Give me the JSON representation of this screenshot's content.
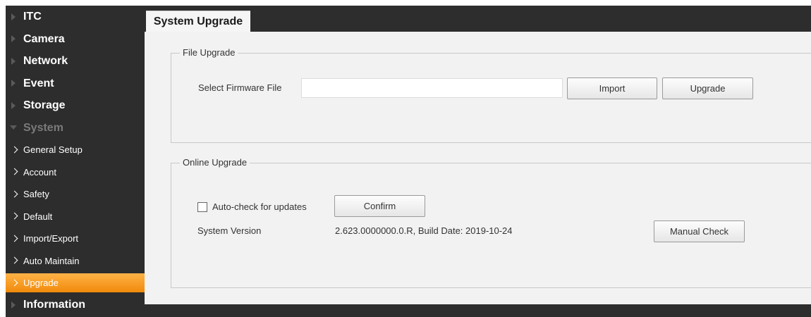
{
  "sidebar": {
    "sections_top": [
      {
        "label": "ITC"
      },
      {
        "label": "Camera"
      },
      {
        "label": "Network"
      },
      {
        "label": "Event"
      },
      {
        "label": "Storage"
      }
    ],
    "system": {
      "label": "System"
    },
    "system_items": [
      {
        "label": "General Setup"
      },
      {
        "label": "Account"
      },
      {
        "label": "Safety"
      },
      {
        "label": "Default"
      },
      {
        "label": "Import/Export"
      },
      {
        "label": "Auto Maintain"
      },
      {
        "label": "Upgrade"
      }
    ],
    "information": {
      "label": "Information"
    }
  },
  "tab": {
    "label": "System Upgrade"
  },
  "file_upgrade": {
    "legend": "File Upgrade",
    "select_label": "Select Firmware File",
    "file_value": "",
    "import_label": "Import",
    "upgrade_label": "Upgrade"
  },
  "online_upgrade": {
    "legend": "Online Upgrade",
    "autocheck_label": "Auto-check for updates",
    "autocheck_checked": false,
    "confirm_label": "Confirm",
    "version_label": "System Version",
    "version_value": "2.623.0000000.0.R, Build Date: 2019-10-24",
    "manual_check_label": "Manual Check"
  },
  "colors": {
    "sidebar_bg": "#2d2d2d",
    "active_item": "#f08a0a",
    "content_bg": "#f2f2f2"
  }
}
